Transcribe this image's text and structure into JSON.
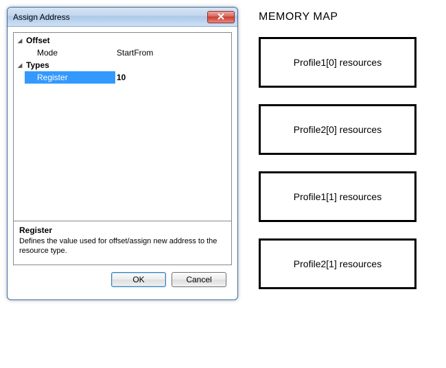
{
  "dialog": {
    "title": "Assign Address",
    "propgrid": {
      "sections": [
        {
          "name": "Offset",
          "rows": [
            {
              "key": "Mode",
              "value": "StartFrom",
              "selected": false
            }
          ]
        },
        {
          "name": "Types",
          "rows": [
            {
              "key": "Register",
              "value": "10",
              "selected": true
            }
          ]
        }
      ],
      "description": {
        "name": "Register",
        "text": "Defines the value used for offset/assign new address to the resource type."
      }
    },
    "buttons": {
      "ok": "OK",
      "cancel": "Cancel"
    }
  },
  "memory_map": {
    "title": "MEMORY MAP",
    "blocks": [
      "Profile1[0] resources",
      "Profile2[0] resources",
      "Profile1[1] resources",
      "Profile2[1] resources"
    ]
  }
}
